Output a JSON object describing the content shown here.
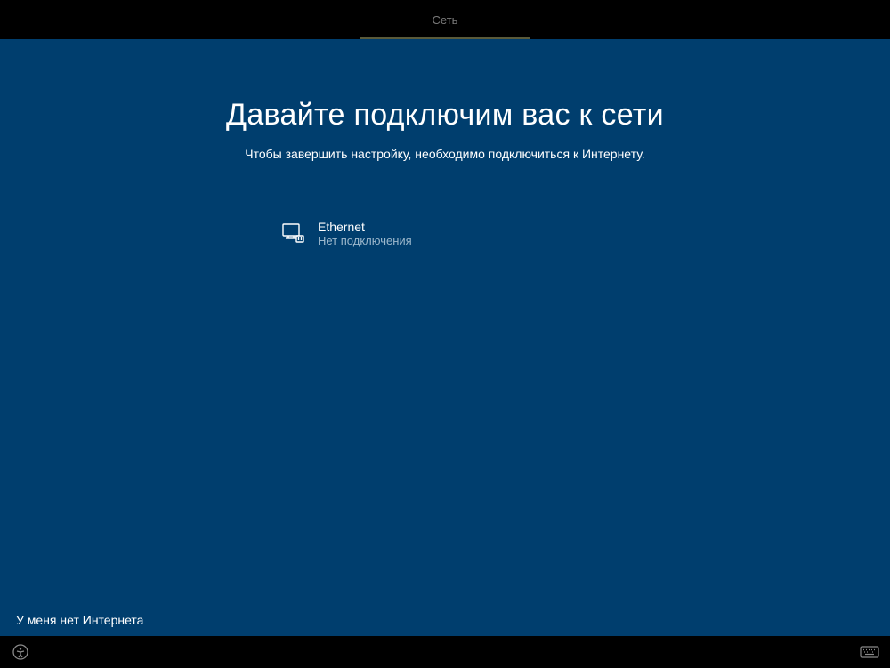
{
  "titlebar": {
    "label": "Сеть"
  },
  "main": {
    "heading": "Давайте подключим вас к сети",
    "subtitle": "Чтобы завершить настройку, необходимо подключиться к Интернету."
  },
  "networks": [
    {
      "name": "Ethernet",
      "status": "Нет подключения"
    }
  ],
  "actions": {
    "skip": "У меня нет Интернета"
  }
}
